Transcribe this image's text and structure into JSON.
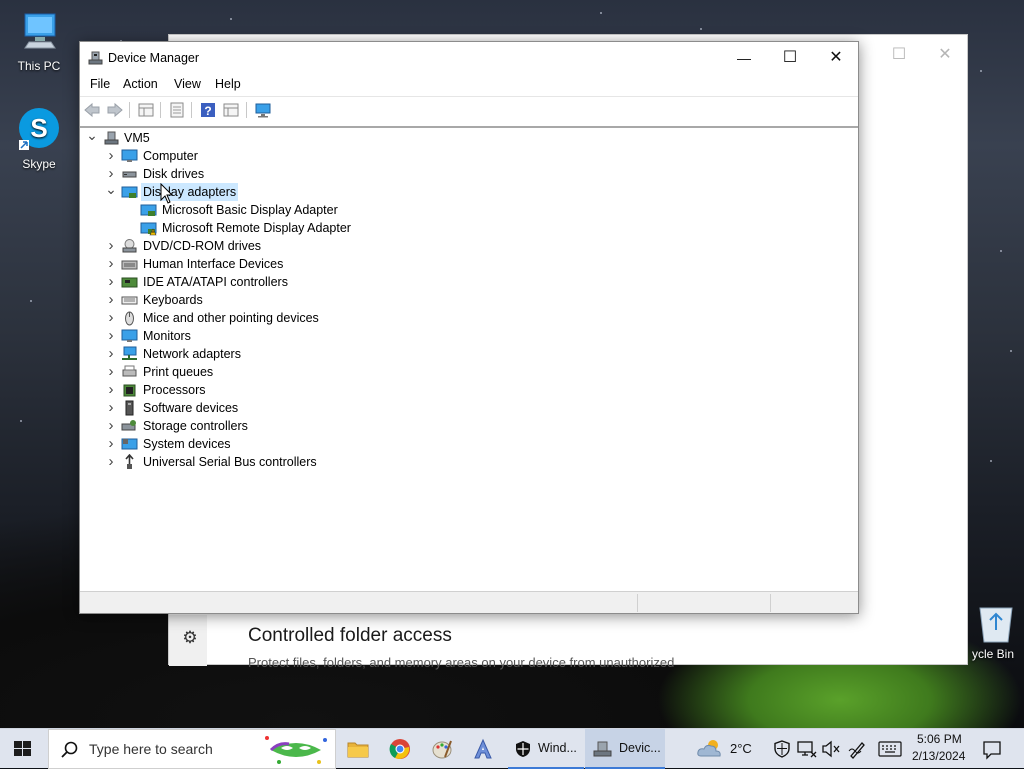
{
  "desktop": {
    "icons": [
      {
        "label": "This PC"
      },
      {
        "label": "Skype"
      },
      {
        "label": "ycle Bin"
      }
    ]
  },
  "bg_window": {
    "section_title": "Controlled folder access",
    "section_desc": "Protect files, folders, and memory areas on your device from unauthorized"
  },
  "device_manager": {
    "title": "Device Manager",
    "caption": {
      "minimize": "—",
      "maximize": "☐",
      "close": "✕"
    },
    "menu": [
      "File",
      "Action",
      "View",
      "Help"
    ],
    "tree": {
      "root": "VM5",
      "categories": [
        {
          "label": "Computer",
          "expanded": false
        },
        {
          "label": "Disk drives",
          "expanded": false
        },
        {
          "label": "Display adapters",
          "expanded": true,
          "selected": true,
          "children": [
            "Microsoft Basic Display Adapter",
            "Microsoft Remote Display Adapter"
          ]
        },
        {
          "label": "DVD/CD-ROM drives",
          "expanded": false
        },
        {
          "label": "Human Interface Devices",
          "expanded": false
        },
        {
          "label": "IDE ATA/ATAPI controllers",
          "expanded": false
        },
        {
          "label": "Keyboards",
          "expanded": false
        },
        {
          "label": "Mice and other pointing devices",
          "expanded": false
        },
        {
          "label": "Monitors",
          "expanded": false
        },
        {
          "label": "Network adapters",
          "expanded": false
        },
        {
          "label": "Print queues",
          "expanded": false
        },
        {
          "label": "Processors",
          "expanded": false
        },
        {
          "label": "Software devices",
          "expanded": false
        },
        {
          "label": "Storage controllers",
          "expanded": false
        },
        {
          "label": "System devices",
          "expanded": false
        },
        {
          "label": "Universal Serial Bus controllers",
          "expanded": false
        }
      ]
    }
  },
  "taskbar": {
    "search_placeholder": "Type here to search",
    "apps": [
      {
        "label": "Wind...",
        "icon": "shield-icon"
      },
      {
        "label": "Devic...",
        "icon": "device-manager-icon"
      }
    ],
    "weather": "2°C",
    "time": "5:06 PM",
    "date": "2/13/2024"
  },
  "colors": {
    "selection": "#cce8ff",
    "taskbar": "#dfe4ee",
    "accent": "#3c7ad6"
  }
}
